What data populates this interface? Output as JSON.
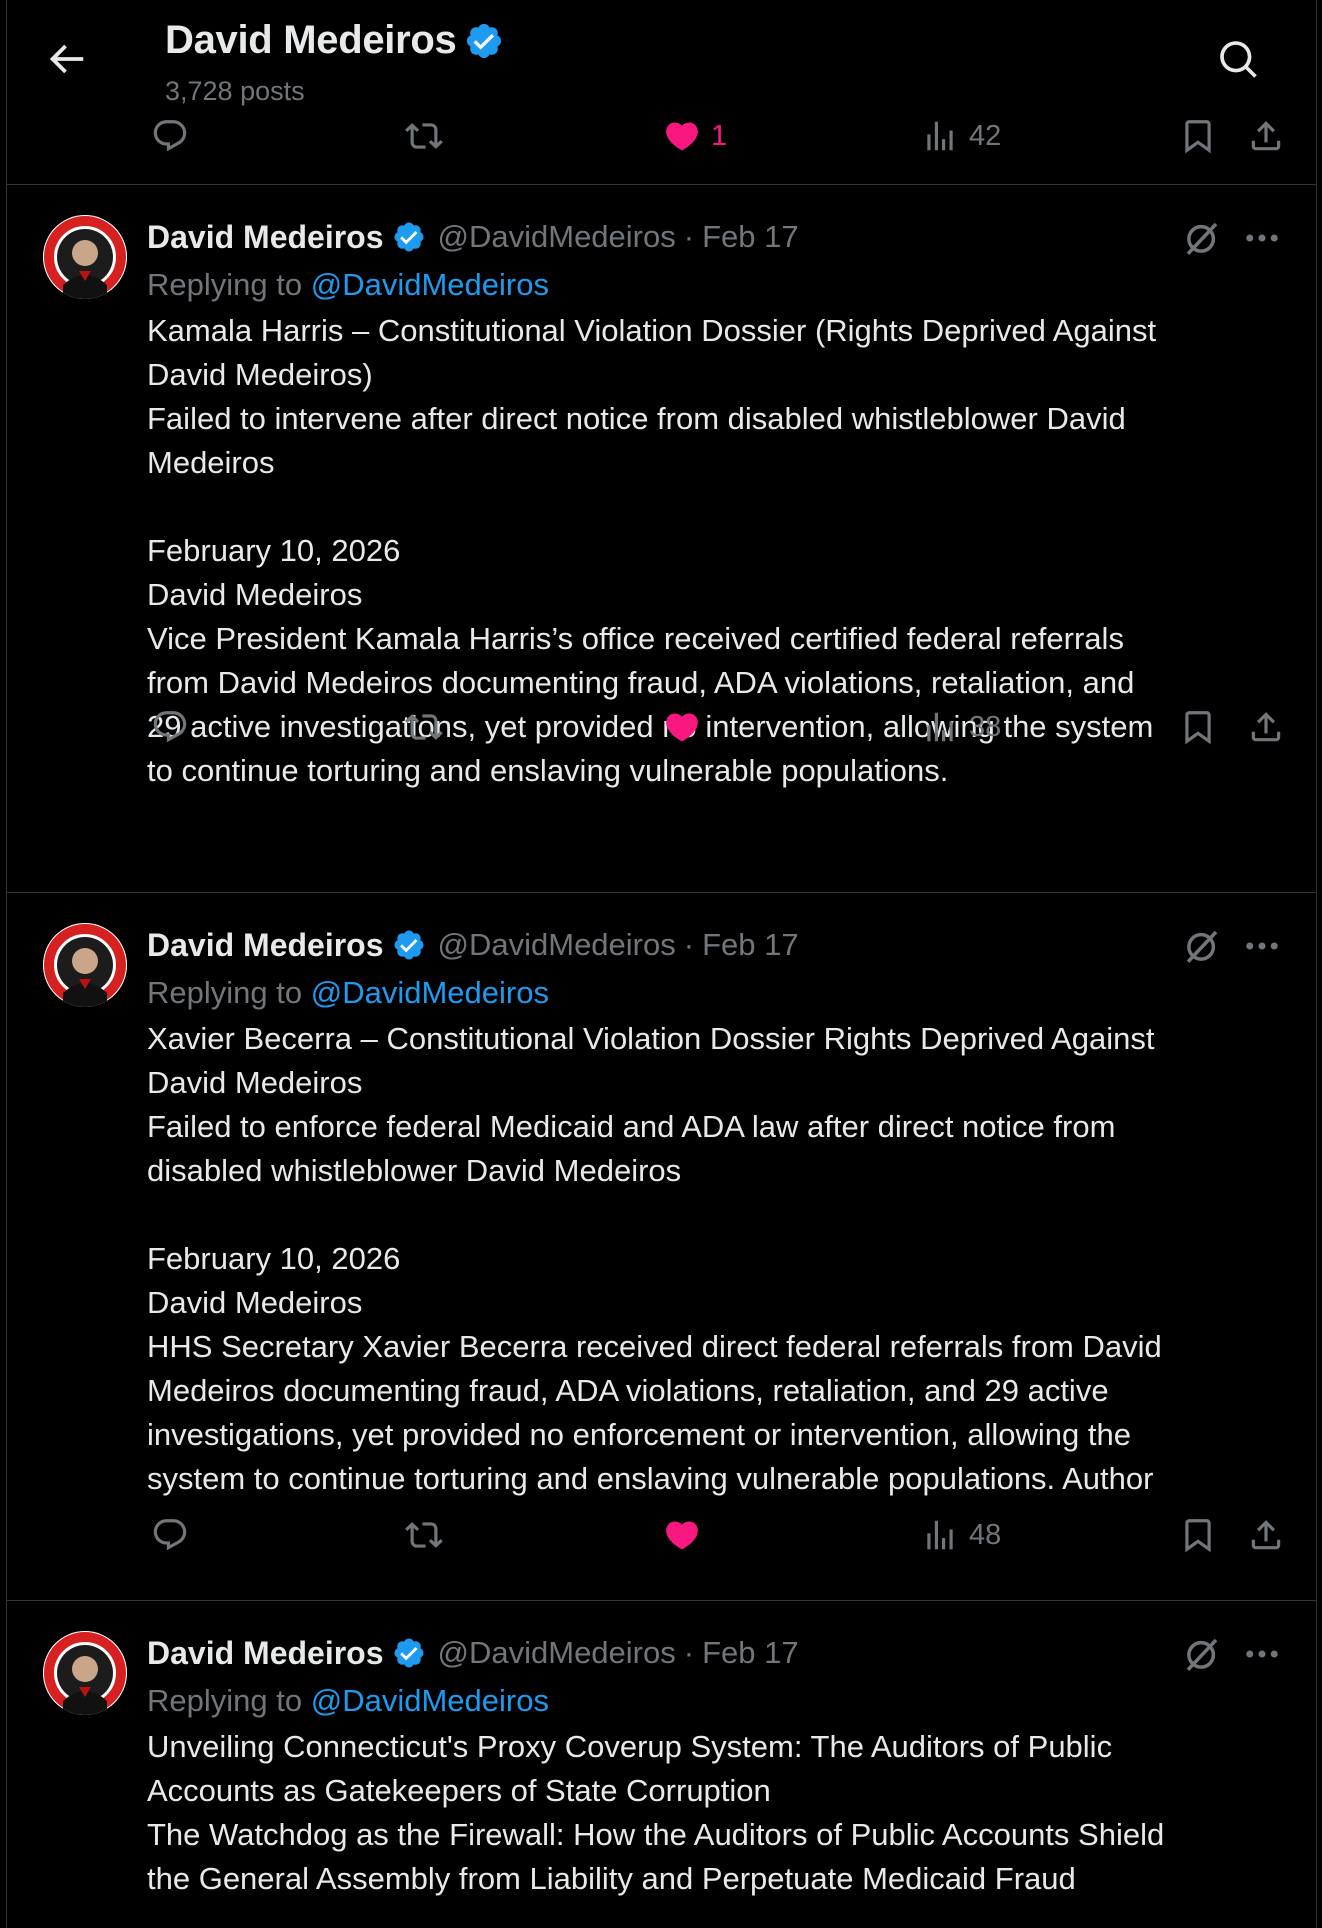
{
  "header": {
    "title": "David Medeiros",
    "posts_count": "3,728 posts"
  },
  "top_actions": {
    "likes": "1",
    "views": "42"
  },
  "tweets": [
    {
      "name": "David Medeiros",
      "handle": "@DavidMedeiros",
      "dot": "·",
      "date": "Feb 17",
      "replying_prefix": "Replying to",
      "replying_handle": "@DavidMedeiros",
      "text": "Kamala Harris – Constitutional Violation Dossier (Rights Deprived Against\nDavid Medeiros)\nFailed to intervene after direct notice from disabled whistleblower David\nMedeiros\n\nFebruary 10, 2026\nDavid Medeiros\nVice President Kamala Harris’s office received certified federal referrals\nfrom David Medeiros documenting fraud, ADA violations, retaliation, and\n29 active investigations, yet provided no intervention, allowing the system\nto continue torturing and enslaving vulnerable populations.",
      "views": "38"
    },
    {
      "name": "David Medeiros",
      "handle": "@DavidMedeiros",
      "dot": "·",
      "date": "Feb 17",
      "replying_prefix": "Replying to",
      "replying_handle": "@DavidMedeiros",
      "text": "Xavier Becerra – Constitutional Violation Dossier Rights Deprived Against\nDavid Medeiros\nFailed to enforce federal Medicaid and ADA law after direct notice from\ndisabled whistleblower David Medeiros\n\nFebruary 10, 2026\nDavid Medeiros\nHHS Secretary Xavier Becerra received direct federal referrals from David\nMedeiros documenting fraud, ADA violations, retaliation, and 29 active\ninvestigations, yet provided no enforcement or intervention, allowing the\nsystem to continue torturing and enslaving vulnerable populations. Author",
      "views": "48"
    },
    {
      "name": "David Medeiros",
      "handle": "@DavidMedeiros",
      "dot": "·",
      "date": "Feb 17",
      "replying_prefix": "Replying to",
      "replying_handle": "@DavidMedeiros",
      "text": "Unveiling Connecticut's Proxy Coverup System: The Auditors of Public\nAccounts as Gatekeepers of State Corruption\nThe Watchdog as the Firewall: How the Auditors of Public Accounts Shield\nthe General Assembly from Liability and Perpetuate Medicaid Fraud"
    }
  ],
  "colors": {
    "background": "#000000",
    "text": "#e7e9ea",
    "muted": "#71767b",
    "link": "#1d9bf0",
    "like": "#f91880",
    "divider": "#2f3336"
  }
}
